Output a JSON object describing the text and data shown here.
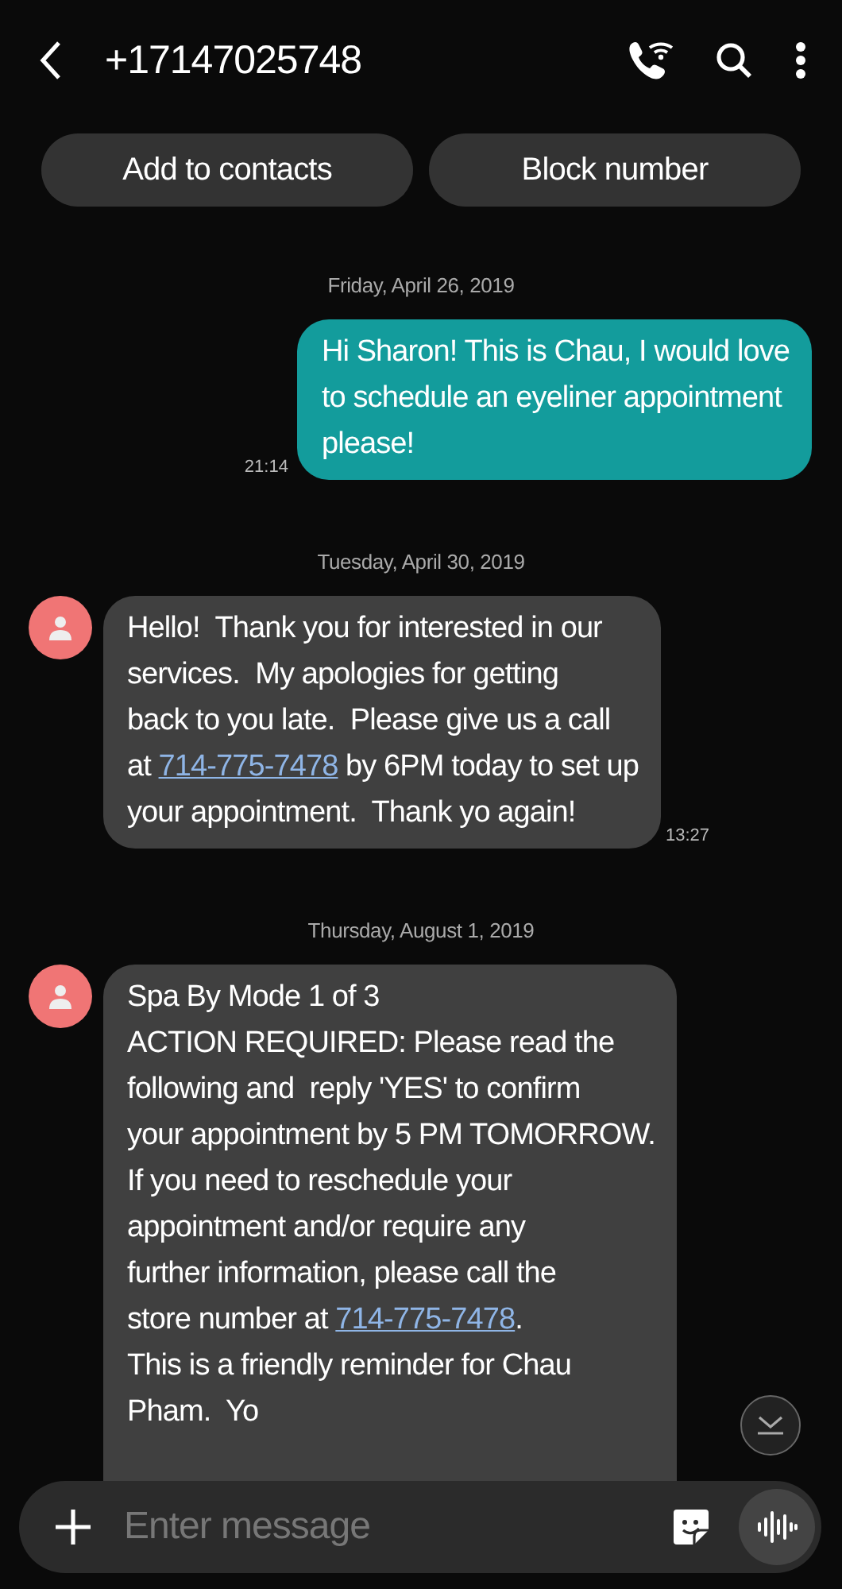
{
  "header": {
    "title": "+17147025748"
  },
  "actions": [
    "Add to contacts",
    "Block number"
  ],
  "messages": [
    {
      "kind": "date",
      "text": "Friday, April 26, 2019"
    },
    {
      "kind": "sent",
      "time": "21:14",
      "parts": [
        {
          "kind": "text",
          "text": "Hi Sharon! This is Chau, I would love\nto schedule an eyeliner appointment\nplease!"
        }
      ]
    },
    {
      "kind": "date",
      "text": "Tuesday, April 30, 2019"
    },
    {
      "kind": "received",
      "time": "13:27",
      "parts": [
        {
          "kind": "text",
          "text": "Hello!  Thank you for interested in our\nservices.  My apologies for getting\nback to you late.  Please give us a call\nat "
        },
        {
          "kind": "link",
          "text": "714-775-7478"
        },
        {
          "kind": "text",
          "text": " by 6PM today to set up\nyour appointment.  Thank yo again!"
        }
      ]
    },
    {
      "kind": "date",
      "text": "Thursday, August 1, 2019"
    },
    {
      "kind": "received",
      "parts": [
        {
          "kind": "text",
          "text": "Spa By Mode 1 of 3\nACTION REQUIRED: Please read the\nfollowing and  reply 'YES' to confirm\nyour appointment by 5 PM TOMORROW.\nIf you need to reschedule your\nappointment and/or require any\nfurther information, please call the\nstore number at "
        },
        {
          "kind": "link",
          "text": "714-775-7478"
        },
        {
          "kind": "text",
          "text": ".\nThis is a friendly reminder for Chau\nPham.  Yo"
        }
      ]
    }
  ],
  "composer": {
    "placeholder": "Enter message"
  }
}
